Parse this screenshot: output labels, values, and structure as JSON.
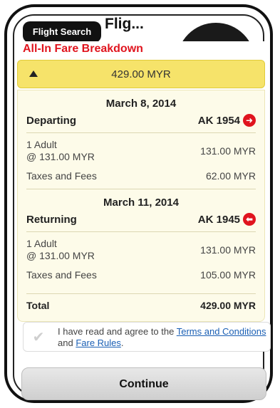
{
  "header": {
    "back_label": "Flight Search",
    "title": "Flig..."
  },
  "breakdown": {
    "title": "All-In Fare Breakdown",
    "total_amount": "429.00 MYR",
    "departing": {
      "date": "March 8, 2014",
      "label": "Departing",
      "flight": "AK 1954",
      "passenger_line1": "1 Adult",
      "passenger_line2": "@ 131.00 MYR",
      "fare": "131.00 MYR",
      "taxes_label": "Taxes and Fees",
      "taxes": "62.00 MYR"
    },
    "returning": {
      "date": "March 11, 2014",
      "label": "Returning",
      "flight": "AK 1945",
      "passenger_line1": "1 Adult",
      "passenger_line2": "@ 131.00 MYR",
      "fare": "131.00 MYR",
      "taxes_label": "Taxes and Fees",
      "taxes": "105.00 MYR"
    },
    "total_label": "Total",
    "total_value": "429.00 MYR"
  },
  "agreement": {
    "prefix": "I have read and agree to the ",
    "terms_link": "Terms and Conditions",
    "middle": " and ",
    "rules_link": "Fare Rules",
    "suffix": "."
  },
  "actions": {
    "continue_label": "Continue"
  },
  "colors": {
    "accent_red": "#e0141e",
    "summary_yellow": "#f6e36a",
    "link_blue": "#1a5fb4"
  }
}
